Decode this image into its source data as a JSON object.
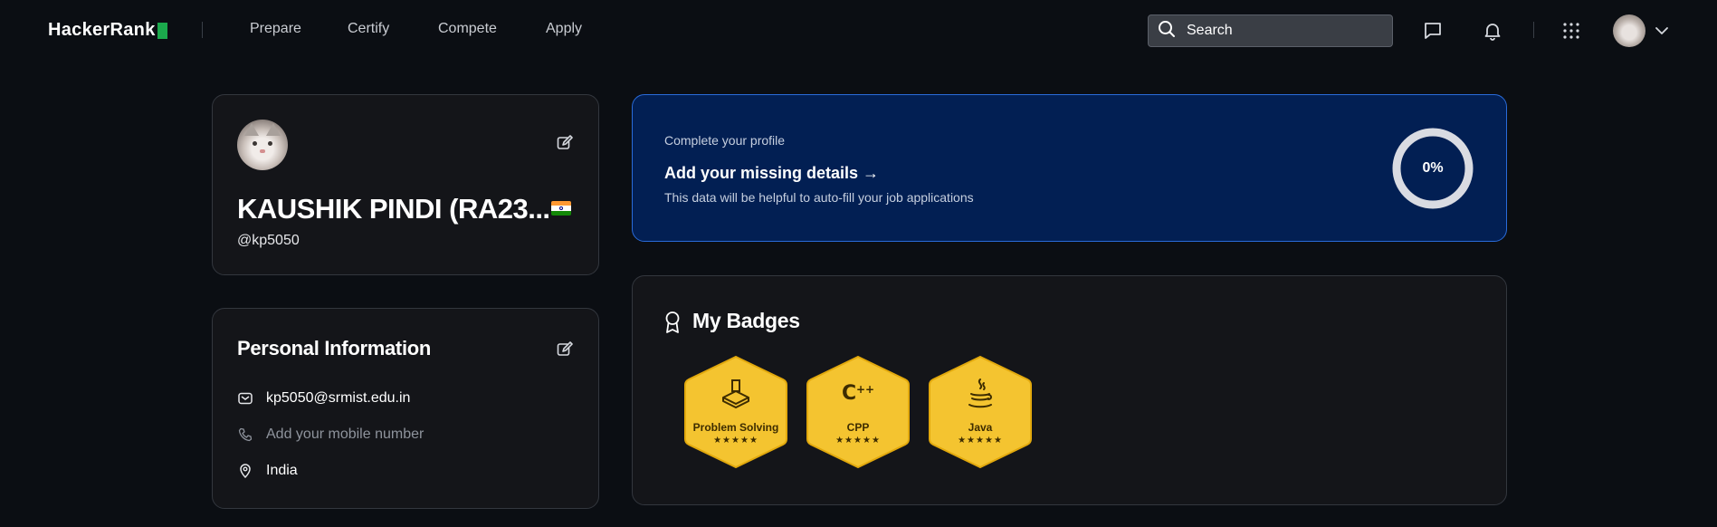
{
  "nav": {
    "brand": "HackerRank",
    "links": [
      "Prepare",
      "Certify",
      "Compete",
      "Apply"
    ],
    "search_placeholder": "Search",
    "icons": [
      "messages-icon",
      "notifications-icon",
      "apps-grid-icon",
      "chevron-down-icon"
    ]
  },
  "profile": {
    "name": "KAUSHIK PINDI (RA23...",
    "handle": "@kp5050",
    "country_flag": "india-flag"
  },
  "personal_info": {
    "title": "Personal Information",
    "email": "kp5050@srmist.edu.in",
    "mobile_placeholder": "Add your mobile number",
    "location": "India"
  },
  "complete_profile": {
    "kicker": "Complete your profile",
    "title": "Add your missing details →",
    "description": "This data will be helpful to auto-fill your job applications",
    "progress_percent": 0,
    "progress_label": "0%"
  },
  "badges": {
    "title": "My Badges",
    "items": [
      {
        "label": "Problem Solving",
        "stars": "★★★★★",
        "icon": "problem-solving-icon"
      },
      {
        "label": "CPP",
        "stars": "★★★★★",
        "icon": "cpp-icon"
      },
      {
        "label": "Java",
        "stars": "★★★★★",
        "icon": "java-icon"
      }
    ]
  },
  "colors": {
    "background": "#0b0e13",
    "card": "#141519",
    "brand_green": "#1ba94c",
    "profile_banner": "#021f53",
    "banner_border": "#2a6bd9",
    "badge_gold": "#f4c430"
  }
}
